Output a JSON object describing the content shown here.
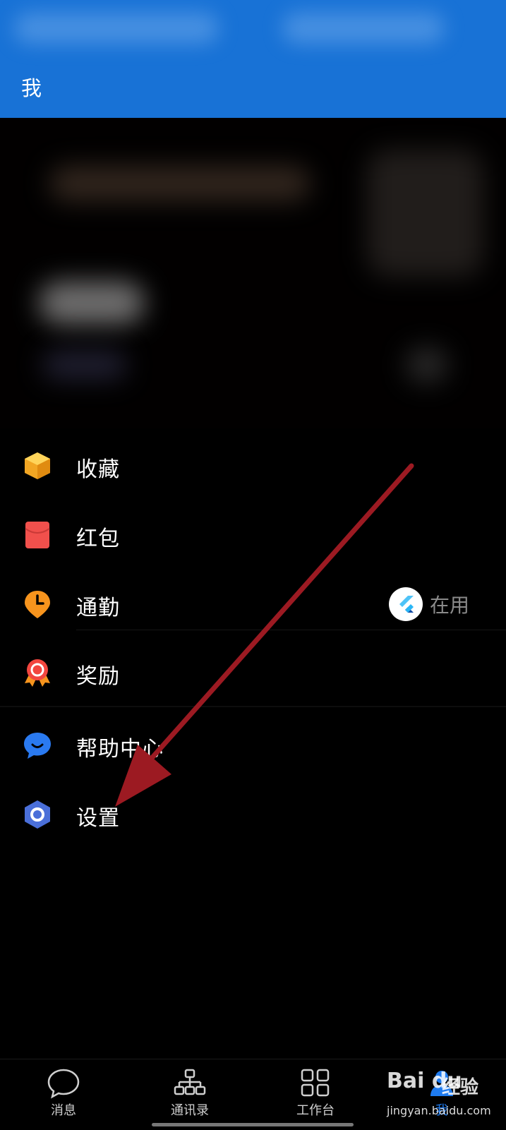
{
  "header": {
    "title": "我",
    "color": "#1872d6"
  },
  "menu": {
    "items": [
      {
        "label": "收藏",
        "icon": "favorites-box-icon"
      },
      {
        "label": "红包",
        "icon": "red-envelope-icon"
      },
      {
        "label": "通勤",
        "icon": "commute-clock-pin-icon",
        "status": "在用"
      },
      {
        "label": "奖励",
        "icon": "reward-medal-icon"
      },
      {
        "label": "帮助中心",
        "icon": "help-chat-icon"
      },
      {
        "label": "设置",
        "icon": "settings-hexagon-icon"
      }
    ]
  },
  "bottom_nav": {
    "items": [
      {
        "label": "消息",
        "icon": "message-bubble-icon"
      },
      {
        "label": "通讯录",
        "icon": "org-chart-icon"
      },
      {
        "label": "工作台",
        "icon": "grid-apps-icon"
      },
      {
        "label": "我",
        "icon": "person-icon",
        "active": true
      }
    ]
  },
  "watermark": {
    "logo": "Bai du",
    "text": "经验",
    "url": "jingyan.baidu.com"
  },
  "annotation": {
    "arrow_color": "#9c1a22"
  }
}
